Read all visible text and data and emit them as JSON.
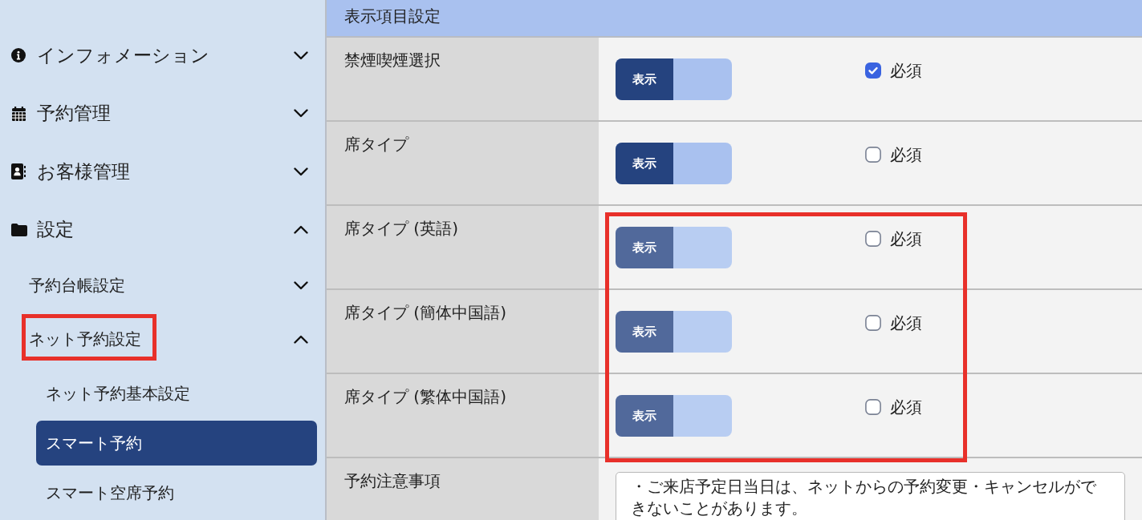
{
  "sidebar": {
    "items": [
      {
        "label": "インフォメーション",
        "expanded": false
      },
      {
        "label": "予約管理",
        "expanded": false
      },
      {
        "label": "お客様管理",
        "expanded": false
      },
      {
        "label": "設定",
        "expanded": true,
        "children": [
          {
            "label": "予約台帳設定",
            "expanded": false,
            "highlighted": false
          },
          {
            "label": "ネット予約設定",
            "expanded": true,
            "highlighted": true,
            "children": [
              {
                "label": "ネット予約基本設定",
                "selected": false
              },
              {
                "label": "スマート予約",
                "selected": true
              },
              {
                "label": "スマート空席予約",
                "selected": false
              }
            ]
          }
        ]
      }
    ]
  },
  "main": {
    "section_title": "表示項目設定",
    "rows": [
      {
        "kind": "toggle",
        "label": "禁煙喫煙選択",
        "toggle": {
          "label": "表示",
          "on": true,
          "disabled": false
        },
        "required": {
          "label": "必須",
          "checked": true
        },
        "highlighted": false
      },
      {
        "kind": "toggle",
        "label": "席タイプ",
        "toggle": {
          "label": "表示",
          "on": true,
          "disabled": false
        },
        "required": {
          "label": "必須",
          "checked": false
        },
        "highlighted": false
      },
      {
        "kind": "toggle",
        "label": "席タイプ (英語)",
        "toggle": {
          "label": "表示",
          "on": true,
          "disabled": true
        },
        "required": {
          "label": "必須",
          "checked": false
        },
        "highlighted": true
      },
      {
        "kind": "toggle",
        "label": "席タイプ (簡体中国語)",
        "toggle": {
          "label": "表示",
          "on": true,
          "disabled": true
        },
        "required": {
          "label": "必須",
          "checked": false
        },
        "highlighted": true
      },
      {
        "kind": "toggle",
        "label": "席タイプ (繁体中国語)",
        "toggle": {
          "label": "表示",
          "on": true,
          "disabled": true
        },
        "required": {
          "label": "必須",
          "checked": false
        },
        "highlighted": true
      },
      {
        "kind": "textarea",
        "label": "予約注意事項",
        "value": "・ご来店予定日当日は、ネットからの予約変更・キャンセルができないことがあります。",
        "highlighted": false
      }
    ]
  }
}
